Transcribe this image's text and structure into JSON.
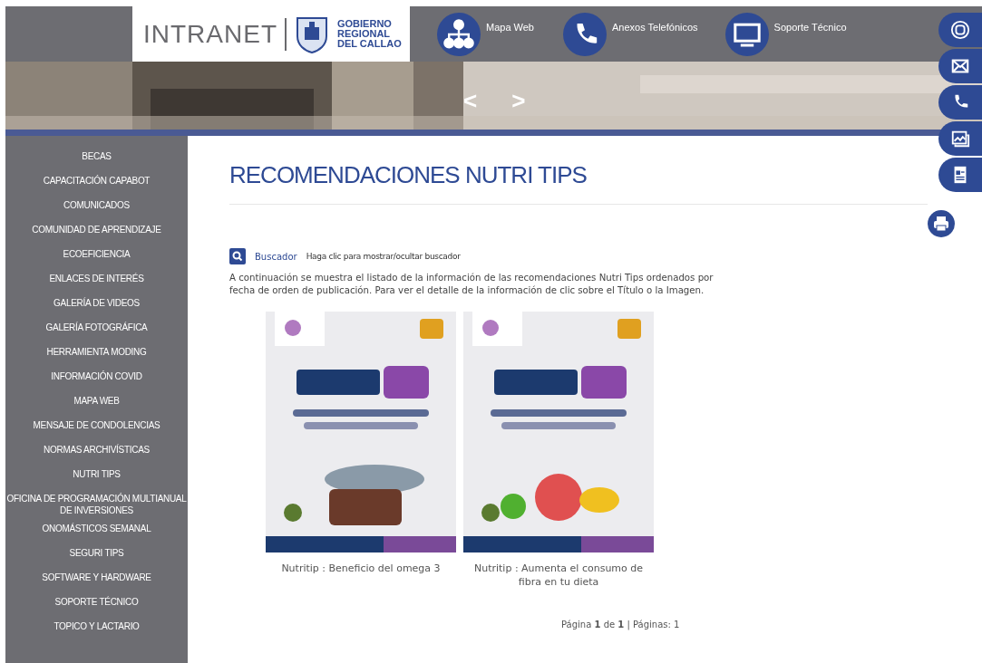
{
  "header": {
    "logo_text": "INTRANET",
    "org_name": [
      "GOBIERNO",
      "REGIONAL",
      "DEL CALLAO"
    ],
    "links": [
      {
        "label": "Mapa Web",
        "kind": "sitemap"
      },
      {
        "label": "Anexos Telefónicos",
        "kind": "phone"
      },
      {
        "label": "Soporte Técnico",
        "kind": "monitor"
      }
    ]
  },
  "banner": {
    "prev": "<",
    "next": ">"
  },
  "side_tabs": [
    {
      "kind": "instagram"
    },
    {
      "kind": "mail"
    },
    {
      "kind": "phone"
    },
    {
      "kind": "gallery"
    },
    {
      "kind": "news"
    }
  ],
  "sidebar": {
    "items": [
      "BECAS",
      "CAPACITACIÓN CAPABOT",
      "COMUNICADOS",
      "COMUNIDAD DE APRENDIZAJE",
      "ECOEFICIENCIA",
      "ENLACES DE INTERÉS",
      "GALERÍA DE VIDEOS",
      "GALERÍA FOTOGRÁFICA",
      "HERRAMIENTA MODING",
      "INFORMACIÓN COVID",
      "MAPA WEB",
      "MENSAJE DE CONDOLENCIAS",
      "NORMAS ARCHIVÍSTICAS",
      "NUTRI TIPS",
      "OFICINA DE PROGRAMACIÓN MULTIANUAL DE INVERSIONES",
      "ONOMÁSTICOS SEMANAL",
      "SEGURI TIPS",
      "SOFTWARE Y HARDWARE",
      "SOPORTE TÉCNICO",
      "TOPICO Y LACTARIO"
    ]
  },
  "page": {
    "title": "RECOMENDACIONES NUTRI TIPS",
    "search": {
      "label": "Buscador",
      "hint": "Haga clic para mostrar/ocultar buscador"
    },
    "intro": "A continuación se muestra el listado de la información de las recomendaciones Nutri Tips ordenados por fecha de orden de publicación. Para ver el detalle de la información de clic sobre el Título o la Imagen.",
    "items": [
      {
        "kind": "picture",
        "caption": "Nutritip : Beneficio del omega 3"
      },
      {
        "kind": "picture",
        "caption": "Nutritip : Aumenta el consumo de fibra en tu dieta"
      }
    ],
    "pagination": "Página **1** de **1** | Páginas: 1"
  }
}
